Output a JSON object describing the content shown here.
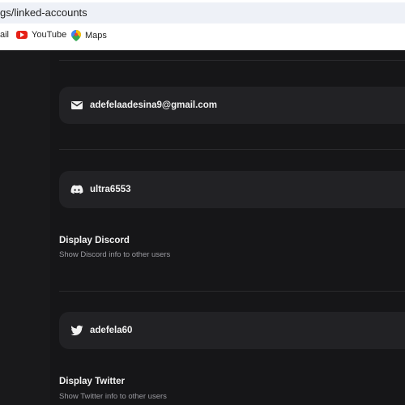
{
  "browser": {
    "url": "gs/linked-accounts",
    "bookmarks": [
      {
        "label": "ail",
        "icon": "gmail-icon"
      },
      {
        "label": "YouTube",
        "icon": "youtube-icon"
      },
      {
        "label": "Maps",
        "icon": "maps-icon"
      }
    ]
  },
  "accounts": {
    "email": {
      "value": "adefelaadesina9@gmail.com",
      "icon": "mail-icon"
    },
    "discord": {
      "value": "ultra6553",
      "icon": "discord-icon"
    },
    "twitter": {
      "value": "adefela60",
      "icon": "twitter-icon"
    }
  },
  "settings": {
    "discord": {
      "title": "Display Discord",
      "description": "Show Discord info to other users"
    },
    "twitter": {
      "title": "Display Twitter",
      "description": "Show Twitter info to other users"
    }
  },
  "colors": {
    "background": "#161618",
    "card": "#222225",
    "text": "#f2f2f2",
    "muted": "#9a9aa0"
  }
}
